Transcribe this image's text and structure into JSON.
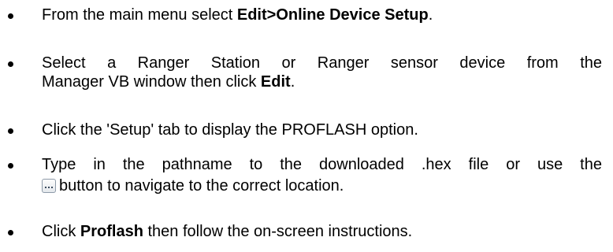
{
  "items": [
    {
      "pre": "From the main menu select ",
      "bold": "Edit>Online Device Setup",
      "post": "."
    },
    {
      "line1": "Select a Ranger Station or Ranger sensor device from the",
      "line2_pre": "Manager VB window then click ",
      "line2_bold": "Edit",
      "line2_post": "."
    },
    {
      "text": "Click the 'Setup' tab to display the PROFLASH option."
    },
    {
      "line1": "Type in the pathname to the downloaded .hex file or use the",
      "line2": "button to navigate to the correct location.",
      "button_icon": "ellipsis-button-icon"
    },
    {
      "pre": "Click ",
      "bold": "Proflash",
      "post": " then follow the on-screen instructions."
    }
  ]
}
